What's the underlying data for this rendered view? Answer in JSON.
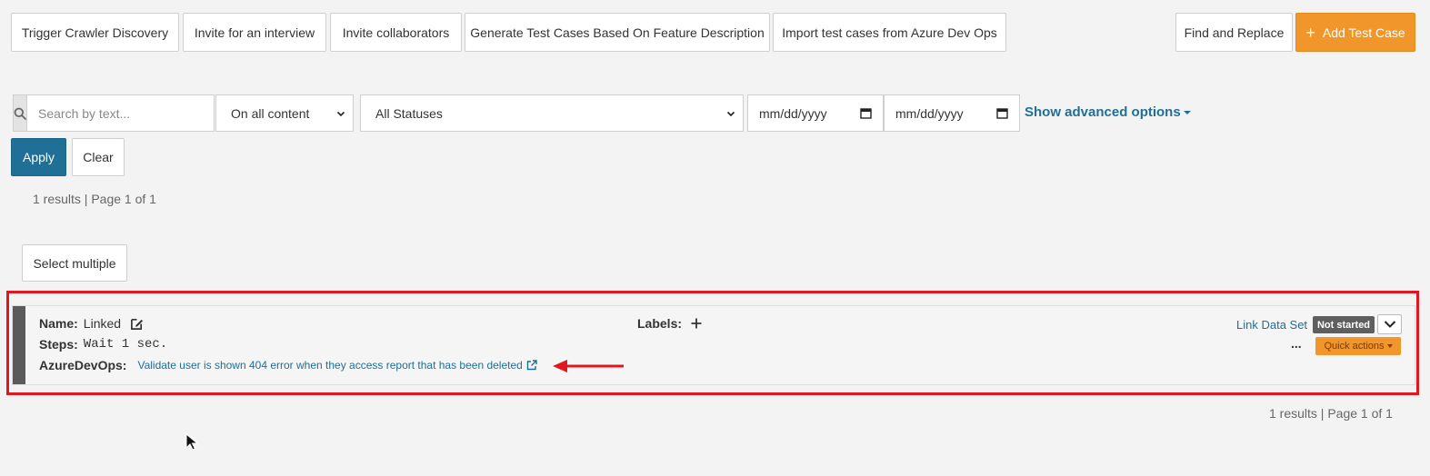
{
  "toolbar": {
    "trigger_crawler": "Trigger Crawler Discovery",
    "invite_interview": "Invite for an interview",
    "invite_collaborators": "Invite collaborators",
    "generate_tests": "Generate Test Cases Based On Feature Description",
    "import_azure": "Import test cases from Azure Dev Ops",
    "find_replace": "Find and Replace",
    "add_test_case": "Add Test Case"
  },
  "filters": {
    "search_placeholder": "Search by text...",
    "content_scope": "On all content",
    "status": "All Statuses",
    "date_from": "mm/dd/yyyy",
    "date_to": "mm/dd/yyyy",
    "advanced": "Show advanced options",
    "apply": "Apply",
    "clear": "Clear"
  },
  "results_top": "1 results | Page 1 of 1",
  "select_multiple": "Select multiple",
  "test_case": {
    "name_label": "Name:",
    "name": "Linked",
    "steps_label": "Steps:",
    "steps": "Wait 1 sec.",
    "azure_label": "AzureDevOps:",
    "azure_link": "Validate user is shown 404 error when they access report that has been deleted",
    "labels_label": "Labels:",
    "link_data_set": "Link Data Set",
    "status": "Not started",
    "more": "...",
    "quick_actions": "Quick actions"
  },
  "results_bottom": "1 results | Page 1 of 1",
  "colors": {
    "accent_orange": "#f0962a",
    "primary_blue": "#1f6f97",
    "highlight_red": "#e2161d"
  }
}
